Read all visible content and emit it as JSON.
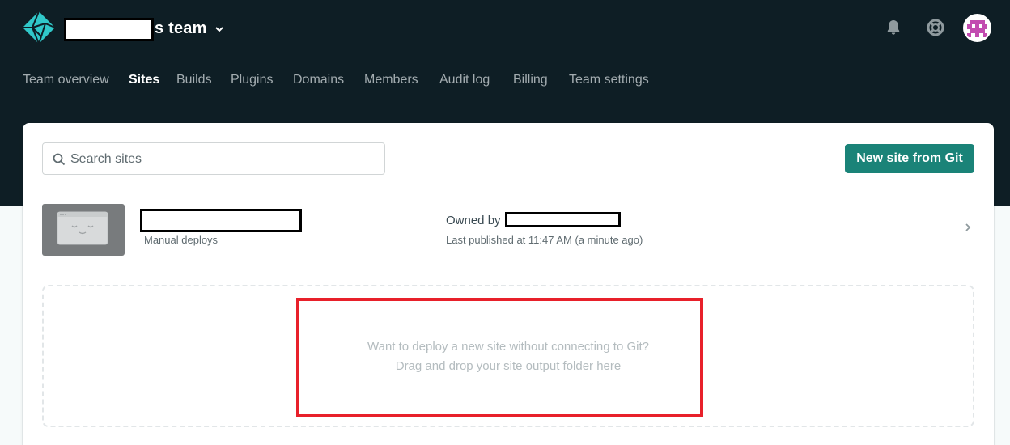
{
  "header": {
    "team_name": "s team",
    "icons": {
      "logo": "netlify-logo-icon",
      "team_dropdown": "chevron-down-icon",
      "notifications": "bell-icon",
      "help": "lifebuoy-icon",
      "avatar": "pixel-avatar"
    },
    "brand_color": "#30c8c9"
  },
  "nav": {
    "tabs": [
      {
        "label": "Team overview"
      },
      {
        "label": "Sites",
        "active": true
      },
      {
        "label": "Builds"
      },
      {
        "label": "Plugins"
      },
      {
        "label": "Domains"
      },
      {
        "label": "Members"
      },
      {
        "label": "Audit log"
      },
      {
        "label": "Billing"
      },
      {
        "label": "Team settings"
      }
    ]
  },
  "main": {
    "search": {
      "placeholder": "Search sites",
      "value": "",
      "icon": "search-icon"
    },
    "new_site_button": "New site from Git",
    "accent_color": "#1a8378",
    "sites": [
      {
        "deploy_method": "Manual deploys",
        "owned_by_label": "Owned by",
        "last_published": "Last published at 11:47 AM (a minute ago)"
      }
    ],
    "dropzone": {
      "line1": "Want to deploy a new site without connecting to Git?",
      "line2": "Drag and drop your site output folder here"
    },
    "highlight_color": "#e8202a"
  }
}
